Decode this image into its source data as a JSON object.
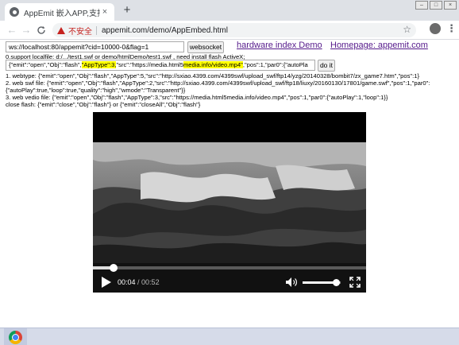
{
  "browser": {
    "tab_title": "AppEmit 嵌入APP,支持播放flash",
    "tab_close": "×",
    "new_tab": "+",
    "nav_back": "←",
    "nav_forward": "→",
    "nav_reload": "C",
    "security_text": "不安全",
    "url": "appemit.com/demo/AppEmbed.html",
    "bookmark_star": "☆",
    "menu_glyph": "⋮",
    "window_controls": [
      "–",
      "□",
      "×"
    ]
  },
  "page": {
    "ws_input_value": "ws://localhost:80/appemit?cid=10000-0&flag=1",
    "websocket_button": "websocket",
    "hardware_link": "hardware index Demo",
    "homepage_link": "Homepage: appemit.com",
    "support_note": "0.support localfile: d:/.../test1.swf or demo/htmlDemo/test1.swf , need install flash ActiveX;",
    "cmd_parts": {
      "pre": "{\"emit\":\"open\",\"Obj\":\"flash\",",
      "hl1": "\"AppType\":3,",
      "mid": "\"src\":\"https://media.html5",
      "hl2": "media.info/video.mp4\"",
      "post": ",\"pos\":1,\"par0\":{\"autoPla"
    },
    "do_it_button": "do it",
    "line_webtype": "1. webtype: {\"emit\":\"open\",\"Obj\":\"flash\",\"AppType\":5,\"src\":\"http://sxiao.4399.com/4399swf/upload_swf/ftp14/yzg/20140328/bombit7/zx_game7.htm\",\"pos\":1}",
    "line_swf_1": "2. web swf file: {\"emit\":\"open\",\"Obj\":\"flash\",\"AppType\":2,\"src\":\"http://sxiao.4399.com/4399swf/upload_swf/ftp18/liuxy/20160130/17801/game.swf\",\"pos\":1,\"par0\":",
    "line_swf_2": "{\"autoPlay\":true,\"loop\":true,\"quality\":\"high\",\"wmode\":\"Transparent\"}}",
    "line_video": "3. web vedio file: {\"emit\":\"open\",\"Obj\":\"flash\",\"AppType\":3,\"src\":\"https://media.html5media.info/video.mp4\",\"pos\":1,\"par0\":{\"autoPlay\":1,\"loop\":1}}",
    "line_close": "close flash: {\"emit\":\"close\",\"Obj\":\"flash\"}        or       {\"emit\":\"closeAll\",\"Obj\":\"flash\"}"
  },
  "video": {
    "current_time": "00:04",
    "separator": " / ",
    "duration": "00:52",
    "progress": 0.077,
    "volume": 0.88
  }
}
